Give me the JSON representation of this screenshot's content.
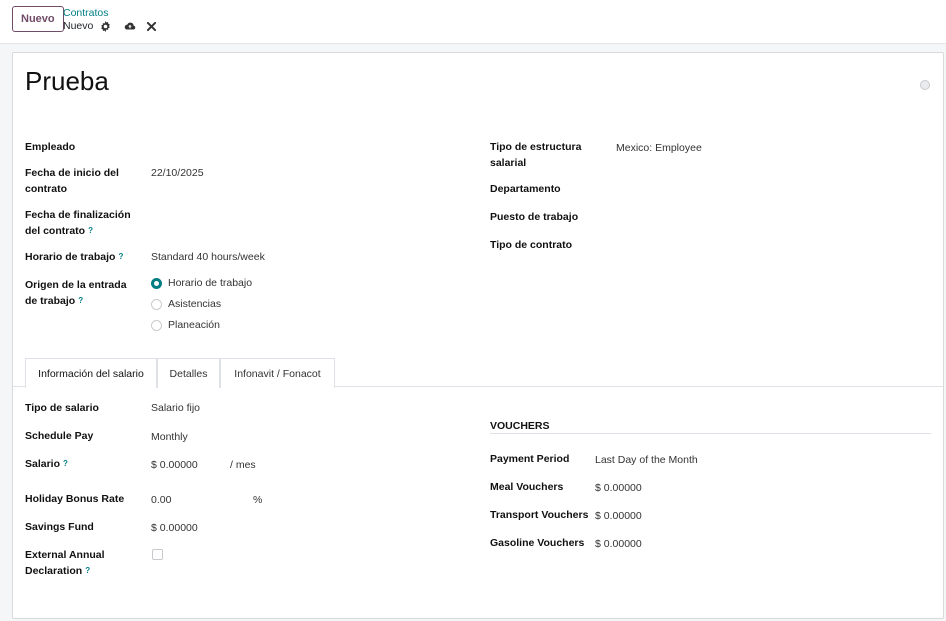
{
  "toolbar": {
    "new_label": "Nuevo",
    "breadcrumb_parent": "Contratos",
    "breadcrumb_current": "Nuevo",
    "icons": [
      "gear-icon",
      "cloud-upload-icon",
      "close-icon"
    ]
  },
  "record": {
    "title": "Prueba"
  },
  "left_fields": {
    "employee_label": "Empleado",
    "start_label_1": "Fecha de inicio del",
    "start_label_2": "contrato",
    "start_value": "22/10/2025",
    "end_label_1": "Fecha de finalización",
    "end_label_2": "del contrato",
    "schedule_label": "Horario de trabajo",
    "schedule_value": "Standard 40 hours/week",
    "origin_label_1": "Origen de la entrada",
    "origin_label_2": "de trabajo",
    "origin_options": [
      "Horario de trabajo",
      "Asistencias",
      "Planeación"
    ],
    "origin_selected": "Horario de trabajo"
  },
  "right_fields": {
    "structure_label_1": "Tipo de estructura",
    "structure_label_2": "salarial",
    "structure_value": "Mexico: Employee",
    "department_label": "Departamento",
    "job_label": "Puesto de trabajo",
    "contract_type_label": "Tipo de contrato"
  },
  "tabs": [
    "Información del salario",
    "Detalles",
    "Infonavit / Fonacot"
  ],
  "salary": {
    "wage_type_label": "Tipo de salario",
    "wage_type_value": "Salario fijo",
    "schedule_pay_label": "Schedule Pay",
    "schedule_pay_value": "Monthly",
    "wage_label": "Salario",
    "wage_value": "$ 0.00000",
    "wage_unit": "/ mes",
    "holiday_label": "Holiday Bonus Rate",
    "holiday_value": "0.00",
    "holiday_unit": "%",
    "savings_label": "Savings Fund",
    "savings_value": "$ 0.00000",
    "external_label_1": "External Annual",
    "external_label_2": "Declaration"
  },
  "vouchers": {
    "title": "VOUCHERS",
    "period_label": "Payment Period",
    "period_value": "Last Day of the Month",
    "meal_label": "Meal Vouchers",
    "meal_value": "$ 0.00000",
    "transport_label": "Transport Vouchers",
    "transport_value": "$ 0.00000",
    "gasoline_label": "Gasoline Vouchers",
    "gasoline_value": "$ 0.00000"
  },
  "help_mark": "?"
}
